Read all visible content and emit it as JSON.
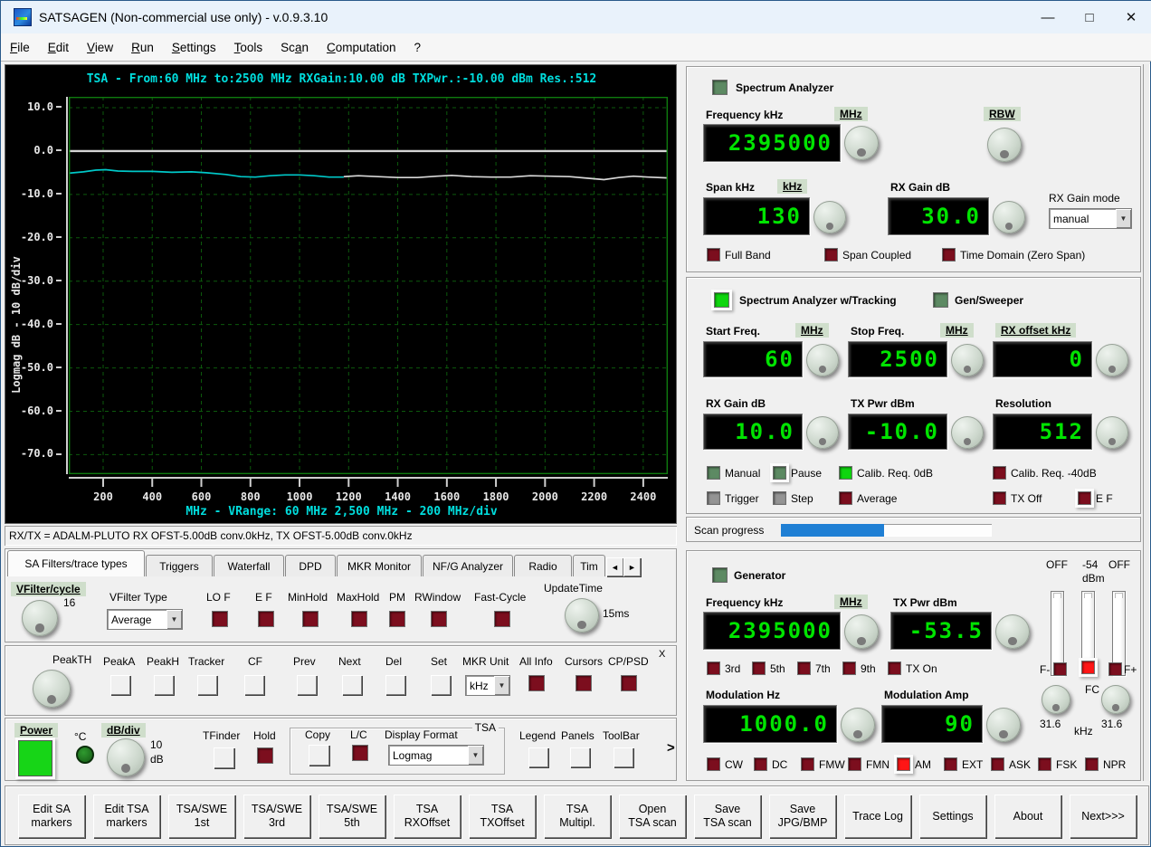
{
  "win": {
    "title": "SATSAGEN (Non-commercial use only) - v.0.9.3.10",
    "minimize": "—",
    "maximize": "□",
    "close": "✕"
  },
  "menu": [
    {
      "pre": "",
      "u": "F",
      "post": "ile"
    },
    {
      "pre": "",
      "u": "E",
      "post": "dit"
    },
    {
      "pre": "",
      "u": "V",
      "post": "iew"
    },
    {
      "pre": "",
      "u": "R",
      "post": "un"
    },
    {
      "pre": "",
      "u": "S",
      "post": "ettings"
    },
    {
      "pre": "",
      "u": "T",
      "post": "ools"
    },
    {
      "pre": "Sc",
      "u": "a",
      "post": "n"
    },
    {
      "pre": "",
      "u": "C",
      "post": "omputation"
    },
    {
      "pre": "?",
      "u": "",
      "post": ""
    }
  ],
  "chart": {
    "status": "RX/TX = ADALM-PLUTO RX OFST-5.00dB conv.0kHz, TX OFST-5.00dB conv.0kHz"
  },
  "chart_data": {
    "type": "line",
    "title": "TSA - From:60 MHz to:2500 MHz RXGain:10.00 dB TXPwr.:-10.00 dBm Res.:512",
    "xlabel": "MHz - VRange: 60 MHz 2,500 MHz - 200 MHz/div",
    "ylabel": "Logmag dB - 10 dB/div",
    "xlim": [
      60,
      2500
    ],
    "ylim": [
      -70,
      10
    ],
    "ylim_draw": [
      -74.5,
      12.5
    ],
    "yticks": [
      10,
      0,
      -10,
      -20,
      -30,
      -40,
      -50,
      -60,
      -70
    ],
    "xticks": [
      200,
      400,
      600,
      800,
      1000,
      1200,
      1400,
      1600,
      1800,
      2000,
      2200,
      2400
    ],
    "grid": "dashed-green",
    "zero_line": true,
    "series": [
      {
        "name": "current-sweep",
        "color": "#00c8c8",
        "points": [
          [
            60,
            -5.1
          ],
          [
            120,
            -4.8
          ],
          [
            170,
            -4.4
          ],
          [
            210,
            -4.3
          ],
          [
            260,
            -4.6
          ],
          [
            320,
            -4.7
          ],
          [
            400,
            -4.7
          ],
          [
            480,
            -4.9
          ],
          [
            560,
            -4.8
          ],
          [
            620,
            -5.0
          ],
          [
            700,
            -5.4
          ],
          [
            760,
            -5.9
          ],
          [
            820,
            -6.0
          ],
          [
            880,
            -5.7
          ],
          [
            940,
            -5.5
          ],
          [
            1000,
            -5.5
          ],
          [
            1060,
            -5.7
          ],
          [
            1120,
            -6.0
          ],
          [
            1180,
            -6.0
          ]
        ]
      },
      {
        "name": "previous-sweep",
        "color": "#d8d8d8",
        "points": [
          [
            1180,
            -5.9
          ],
          [
            1240,
            -5.7
          ],
          [
            1320,
            -5.9
          ],
          [
            1400,
            -6.1
          ],
          [
            1480,
            -6.1
          ],
          [
            1560,
            -5.8
          ],
          [
            1620,
            -5.6
          ],
          [
            1700,
            -5.9
          ],
          [
            1780,
            -6.0
          ],
          [
            1860,
            -6.0
          ],
          [
            1940,
            -5.7
          ],
          [
            2020,
            -5.8
          ],
          [
            2100,
            -5.9
          ],
          [
            2160,
            -6.2
          ],
          [
            2240,
            -6.6
          ],
          [
            2300,
            -6.1
          ],
          [
            2360,
            -5.8
          ],
          [
            2420,
            -6.0
          ],
          [
            2500,
            -6.2
          ]
        ]
      }
    ]
  },
  "sa": {
    "title": "Spectrum Analyzer",
    "title_state": "dimgreen",
    "freq_label": "Frequency kHz",
    "mhz": "MHz",
    "rbw": "RBW",
    "freq": "2395000",
    "span_label": "Span kHz",
    "khz": "kHz",
    "span": "130",
    "rxgain_label": "RX Gain dB",
    "rxgain": "30.0",
    "rxgain_mode_label": "RX Gain mode",
    "rxgain_mode": "manual",
    "checks": [
      {
        "label": "Full Band",
        "state": "darkred"
      },
      {
        "label": "Span Coupled",
        "state": "darkred"
      },
      {
        "label": "Time Domain (Zero Span)",
        "state": "darkred"
      }
    ]
  },
  "trk": {
    "title": "Spectrum Analyzer w/Tracking",
    "title_state": "green framed",
    "gen_sweeper": "Gen/Sweeper",
    "gen_sweeper_state": "dimgreen",
    "start_label": "Start Freq.",
    "mhz1": "MHz",
    "start": "60",
    "stop_label": "Stop Freq.",
    "mhz2": "MHz",
    "stop": "2500",
    "rxoff_label": "RX offset kHz",
    "rxoff": "0",
    "rxgain_label": "RX Gain dB",
    "rxgain": "10.0",
    "txpwr_label": "TX Pwr dBm",
    "txpwr": "-10.0",
    "res_label": "Resolution",
    "res": "512",
    "checks_row1": [
      {
        "label": "Manual",
        "state": "dimgreen"
      },
      {
        "label": "Pause",
        "state": "dimgreen framed"
      },
      {
        "label": "Calib. Req. 0dB",
        "state": "green"
      },
      {
        "label": "Calib. Req. -40dB",
        "state": "darkred"
      }
    ],
    "checks_row2": [
      {
        "label": "Trigger",
        "state": "gray"
      },
      {
        "label": "Step",
        "state": "gray"
      },
      {
        "label": "Average",
        "state": "darkred"
      },
      {
        "label": "TX Off",
        "state": "darkred"
      },
      {
        "label": "E F",
        "state": "darkred framed"
      }
    ],
    "scan_label": "Scan progress",
    "progress_pct": 49
  },
  "gen": {
    "title": "Generator",
    "title_state": "dimgreen",
    "meter_left": "OFF",
    "meter_mid": "-54",
    "meter_right": "OFF",
    "meter_unit": "dBm",
    "freq_label": "Frequency kHz",
    "mhz": "MHz",
    "freq": "2395000",
    "txpwr_label": "TX Pwr dBm",
    "txpwr": "-53.5",
    "harmonics": [
      {
        "label": "3rd",
        "state": "darkred"
      },
      {
        "label": "5th",
        "state": "darkred"
      },
      {
        "label": "7th",
        "state": "darkred"
      },
      {
        "label": "9th",
        "state": "darkred"
      },
      {
        "label": "TX On",
        "state": "darkred"
      }
    ],
    "fminus": "F-",
    "fminus_state": "darkred",
    "fc": "FC",
    "fc_state": "red framed",
    "fplus": "F+",
    "fplus_state": "darkred",
    "knob_left_val": "31.6",
    "knob_unit": "kHz",
    "knob_right_val": "31.6",
    "mod_hz_label": "Modulation Hz",
    "mod_hz": "1000.0",
    "mod_amp_label": "Modulation Amp",
    "mod_amp": "90",
    "modes": [
      {
        "label": "CW",
        "state": "darkred"
      },
      {
        "label": "DC",
        "state": "darkred"
      },
      {
        "label": "FMW",
        "state": "darkred"
      },
      {
        "label": "FMN",
        "state": "darkred"
      },
      {
        "label": "AM",
        "state": "red framed"
      },
      {
        "label": "EXT",
        "state": "darkred"
      },
      {
        "label": "ASK",
        "state": "darkred"
      },
      {
        "label": "FSK",
        "state": "darkred"
      },
      {
        "label": "NPR",
        "state": "darkred"
      }
    ]
  },
  "tabsbar": {
    "items": [
      {
        "label": "SA Filters/trace types"
      },
      {
        "label": "Triggers"
      },
      {
        "label": "Waterfall"
      },
      {
        "label": "DPD"
      },
      {
        "label": "MKR Monitor"
      },
      {
        "label": "NF/G Analyzer"
      },
      {
        "label": "Radio"
      },
      {
        "label": "Tim"
      }
    ],
    "left_arrow": "◄",
    "right_arrow": "►"
  },
  "filt": {
    "vcycle_label": "VFilter/cycle",
    "vcycle": "16",
    "vtype_label": "VFilter Type",
    "vtype": "Average",
    "checks": [
      {
        "label": "LO F",
        "state": "darkred"
      },
      {
        "label": "E F",
        "state": "darkred"
      },
      {
        "label": "MinHold",
        "state": "darkred"
      },
      {
        "label": "MaxHold",
        "state": "darkred"
      },
      {
        "label": "PM",
        "state": "darkred"
      },
      {
        "label": "RWindow",
        "state": "darkred"
      },
      {
        "label": "Fast-Cycle",
        "state": "darkred"
      }
    ],
    "update_label": "UpdateTime",
    "update": "15ms"
  },
  "mkr": {
    "peakth": "PeakTH",
    "buttons": [
      "PeakA",
      "PeakH",
      "Tracker",
      "CF",
      "Prev",
      "Next",
      "Del",
      "Set"
    ],
    "unit_label": "MKR Unit",
    "unit": "kHz",
    "checks": [
      {
        "label": "All Info",
        "state": "darkred"
      },
      {
        "label": "Cursors",
        "state": "darkred"
      },
      {
        "label": "CP/PSD",
        "state": "darkred"
      }
    ],
    "close": "X"
  },
  "pwr": {
    "power_label": "Power",
    "temp_label": "°C",
    "dbdiv_label": "dB/div",
    "dbdiv_val": "10",
    "dbdiv_unit": "dB",
    "tfinder": "TFinder",
    "hold": "Hold",
    "hold_state": "darkred",
    "tsa_group": "TSA",
    "copy": "Copy",
    "lc": "L/C",
    "lc_state": "darkred",
    "dformat_label": "Display Format",
    "dformat": "Logmag",
    "legend": "Legend",
    "panels": "Panels",
    "toolbar": "ToolBar",
    "more": ">"
  },
  "tb": {
    "buttons": [
      {
        "line1": "Edit SA",
        "line2": "markers"
      },
      {
        "line1": "Edit TSA",
        "line2": "markers"
      },
      {
        "line1": "TSA/SWE",
        "line2": "1st"
      },
      {
        "line1": "TSA/SWE",
        "line2": "3rd"
      },
      {
        "line1": "TSA/SWE",
        "line2": "5th"
      },
      {
        "line1": "TSA",
        "line2": "RXOffset"
      },
      {
        "line1": "TSA",
        "line2": "TXOffset"
      },
      {
        "line1": "TSA",
        "line2": "Multipl."
      },
      {
        "line1": "Open",
        "line2": "TSA scan"
      },
      {
        "line1": "Save",
        "line2": "TSA scan"
      },
      {
        "line1": "Save",
        "line2": "JPG/BMP"
      },
      {
        "line1": "Trace Log",
        "line2": ""
      },
      {
        "line1": "Settings",
        "line2": ""
      },
      {
        "line1": "About",
        "line2": ""
      },
      {
        "line1": "Next>>>",
        "line2": ""
      }
    ]
  }
}
